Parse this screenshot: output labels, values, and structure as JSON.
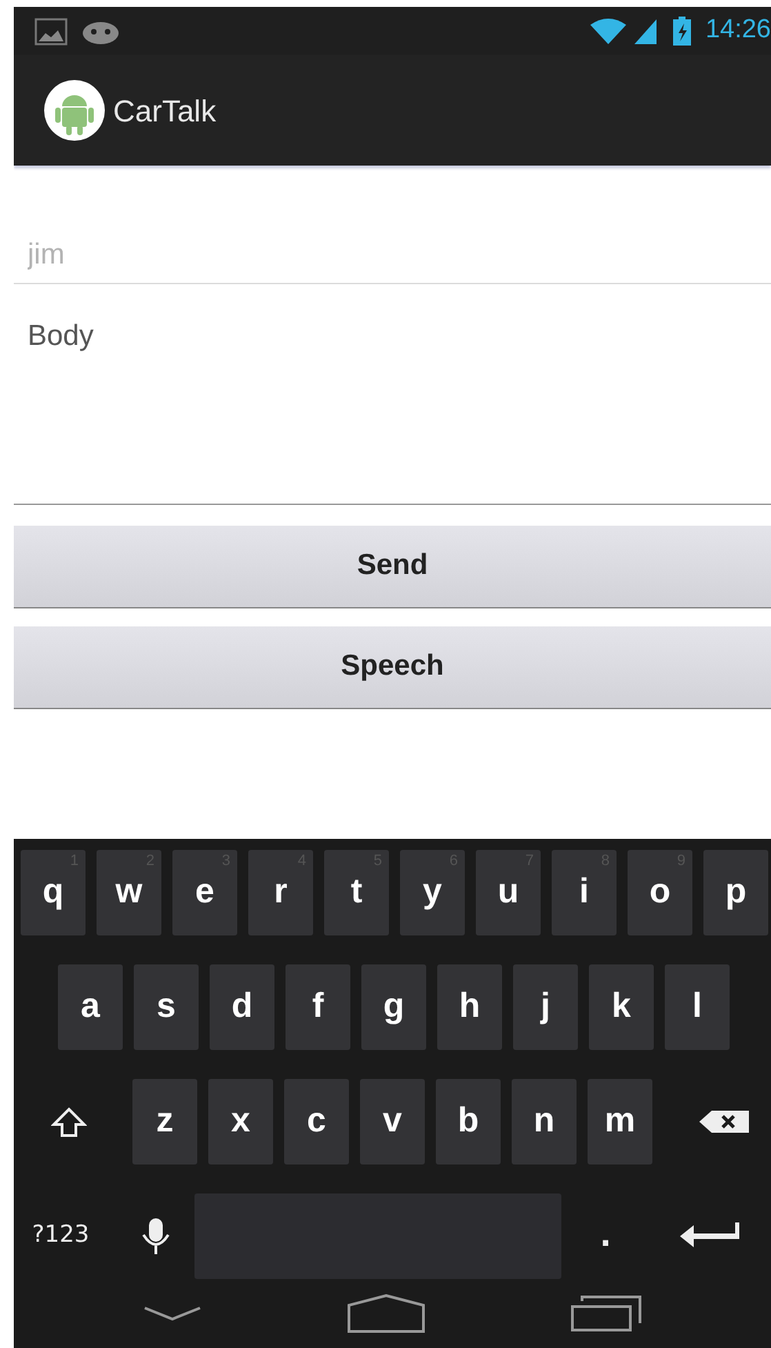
{
  "status_bar": {
    "time": "14:26"
  },
  "action_bar": {
    "title": "CarTalk"
  },
  "form": {
    "to_field": {
      "placeholder": "jim"
    },
    "body_field": {
      "value": "Body"
    }
  },
  "buttons": [
    {
      "label": "Send"
    },
    {
      "label": "Speech"
    }
  ],
  "keyboard": {
    "rows": [
      [
        {
          "kind": "letter",
          "label": "q",
          "hint": "1"
        },
        {
          "kind": "letter",
          "label": "w",
          "hint": "2"
        },
        {
          "kind": "letter",
          "label": "e",
          "hint": "3"
        },
        {
          "kind": "letter",
          "label": "r",
          "hint": "4"
        },
        {
          "kind": "letter",
          "label": "t",
          "hint": "5"
        },
        {
          "kind": "letter",
          "label": "y",
          "hint": "6"
        },
        {
          "kind": "letter",
          "label": "u",
          "hint": "7"
        },
        {
          "kind": "letter",
          "label": "i",
          "hint": "8"
        },
        {
          "kind": "letter",
          "label": "o",
          "hint": "9"
        },
        {
          "kind": "letter",
          "label": "p"
        }
      ],
      [
        {
          "kind": "letter",
          "label": "a"
        },
        {
          "kind": "letter",
          "label": "s"
        },
        {
          "kind": "letter",
          "label": "d"
        },
        {
          "kind": "letter",
          "label": "f"
        },
        {
          "kind": "letter",
          "label": "g"
        },
        {
          "kind": "letter",
          "label": "h"
        },
        {
          "kind": "letter",
          "label": "j"
        },
        {
          "kind": "letter",
          "label": "k"
        },
        {
          "kind": "letter",
          "label": "l"
        }
      ],
      [
        {
          "kind": "shift"
        },
        {
          "kind": "letter",
          "label": "z"
        },
        {
          "kind": "letter",
          "label": "x"
        },
        {
          "kind": "letter",
          "label": "c"
        },
        {
          "kind": "letter",
          "label": "v"
        },
        {
          "kind": "letter",
          "label": "b"
        },
        {
          "kind": "letter",
          "label": "n"
        },
        {
          "kind": "letter",
          "label": "m"
        },
        {
          "kind": "backspace"
        }
      ],
      [
        {
          "kind": "symbols",
          "label": "?123"
        },
        {
          "kind": "mic"
        },
        {
          "kind": "space"
        },
        {
          "kind": "period",
          "label": "."
        },
        {
          "kind": "enter"
        }
      ]
    ]
  }
}
